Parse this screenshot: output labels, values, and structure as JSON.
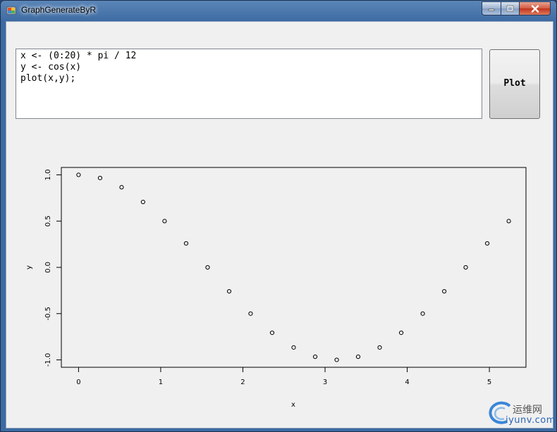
{
  "window": {
    "title": "GraphGenerateByR"
  },
  "editor": {
    "code": "x <- (0:20) * pi / 12\ny <- cos(x)\nplot(x,y);"
  },
  "toolbar": {
    "plot_label": "Plot"
  },
  "icons": {
    "app": "app-icon",
    "minimize": "minimize-icon",
    "maximize": "maximize-icon",
    "close": "close-icon"
  },
  "chart_data": {
    "type": "scatter",
    "xlabel": "x",
    "ylabel": "y",
    "title": "",
    "xlim": [
      0,
      5.236
    ],
    "ylim": [
      -1,
      1
    ],
    "xticks": [
      "0",
      "1",
      "2",
      "3",
      "4",
      "5"
    ],
    "yticks": [
      "-1.0",
      "-0.5",
      "0.0",
      "0.5",
      "1.0"
    ],
    "grid": false,
    "x": [
      0,
      0.262,
      0.524,
      0.785,
      1.047,
      1.309,
      1.571,
      1.833,
      2.094,
      2.356,
      2.618,
      2.88,
      3.142,
      3.403,
      3.665,
      3.927,
      4.189,
      4.451,
      4.712,
      4.974,
      5.236
    ],
    "y": [
      1.0,
      0.966,
      0.866,
      0.707,
      0.5,
      0.259,
      0.0,
      -0.259,
      -0.5,
      -0.707,
      -0.866,
      -0.966,
      -1.0,
      -0.966,
      -0.866,
      -0.707,
      -0.5,
      -0.259,
      0.0,
      0.259,
      0.5
    ]
  },
  "watermark": {
    "cn": "运维网",
    "en": "iyunv.com"
  }
}
